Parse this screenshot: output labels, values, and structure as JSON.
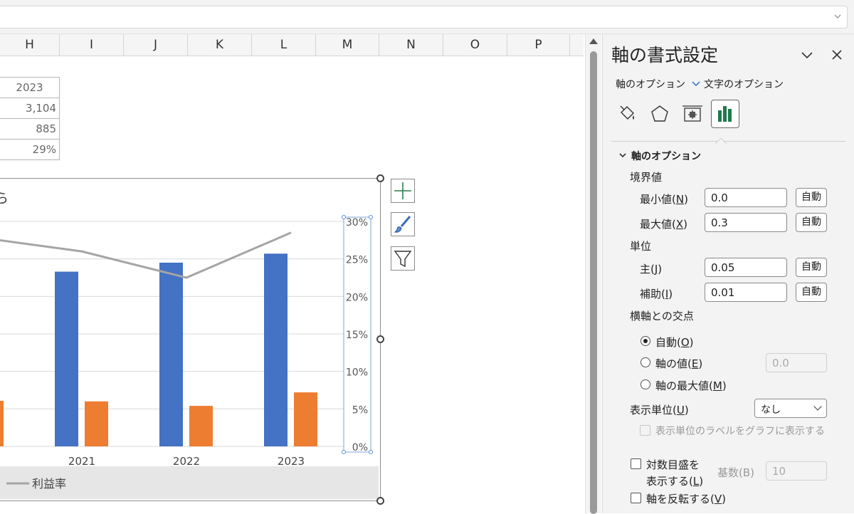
{
  "columns": [
    "H",
    "I",
    "J",
    "K",
    "L",
    "M",
    "N",
    "O",
    "P"
  ],
  "table": {
    "rows": [
      "2023",
      "3,104",
      "885",
      "29%"
    ]
  },
  "chart_data": {
    "type": "bar",
    "title": "",
    "categories": [
      "2021",
      "2022",
      "2023"
    ],
    "series": [
      {
        "name": "",
        "type": "bar",
        "color": "#4472C4",
        "values": [
          2330,
          2450,
          2570
        ]
      },
      {
        "name": "",
        "type": "bar",
        "color": "#ED7D31",
        "values": [
          600,
          540,
          720
        ]
      },
      {
        "name": "利益率",
        "type": "line",
        "axis": "secondary",
        "color": "#A5A5A5",
        "values": [
          0.26,
          0.225,
          0.285
        ]
      }
    ],
    "secondary_axis": {
      "ticks": [
        "0%",
        "5%",
        "10%",
        "15%",
        "20%",
        "25%",
        "30%"
      ],
      "ylim": [
        0,
        0.3
      ]
    },
    "legend": [
      "利益率"
    ],
    "title_fragment": "ら",
    "grid": true
  },
  "pane": {
    "title": "軸の書式設定",
    "tab_axis": "軸のオプション",
    "tab_text": "文字のオプション",
    "section": "軸のオプション",
    "bounds": "境界値",
    "min_label": "最小値(",
    "min_key": "N",
    "min_value": "0.0",
    "max_label": "最大値(",
    "max_key": "X",
    "max_value": "0.3",
    "auto": "自動",
    "units": "単位",
    "major_label": "主(",
    "major_key": "J",
    "major_value": "0.05",
    "minor_label": "補助(",
    "minor_key": "I",
    "minor_value": "0.01",
    "cross": "横軸との交点",
    "cross_auto": "自動(",
    "cross_auto_key": "O",
    "cross_value": "軸の値(",
    "cross_value_key": "E",
    "cross_value_input": "0.0",
    "cross_max": "軸の最大値(",
    "cross_max_key": "M",
    "display_unit": "表示単位(",
    "display_unit_key": "U",
    "display_unit_value": "なし",
    "show_unit_label": "表示単位のラベルをグラフに表示する",
    "log_line1": "対数目盛を",
    "log_line2": "表示する(",
    "log_key": "L",
    "base_label": "基数(B)",
    "base_value": "10",
    "reverse": "軸を反転する(",
    "reverse_key": "V"
  }
}
